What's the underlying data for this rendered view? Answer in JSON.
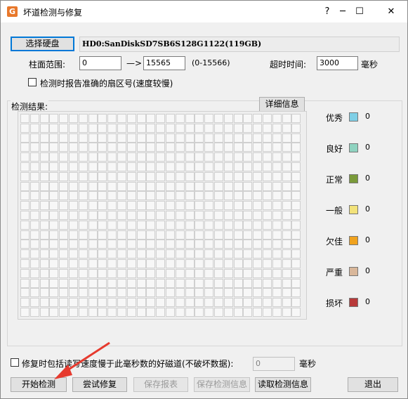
{
  "window": {
    "title": "坏道检测与修复",
    "app_icon_glyph": "G",
    "controls": {
      "help": "?",
      "minimize": "─",
      "maximize": "☐",
      "close": "✕"
    }
  },
  "disk": {
    "select_label": "选择硬盘",
    "selected": "HD0:SanDiskSD7SB6S128G1122(119GB)"
  },
  "range": {
    "label": "柱面范围:",
    "start": "0",
    "arrow": "—>",
    "end": "15565",
    "hint": "(0-15566)"
  },
  "timeout": {
    "label": "超时时间:",
    "value": "3000",
    "unit": "毫秒"
  },
  "options": {
    "report_sector_label": "检测时报告准确的扇区号(速度较慢)",
    "report_sector_checked": false,
    "repair_slow_label": "修复时包括读写速度慢于此毫秒数的好磁道(不破坏数据):",
    "repair_slow_checked": false,
    "repair_slow_value": "0",
    "repair_slow_unit": "毫秒"
  },
  "results": {
    "label": "检测结果:",
    "details_button": "详细信息"
  },
  "legend": [
    {
      "label": "优秀",
      "color": "#7fcfe6",
      "count": "0"
    },
    {
      "label": "良好",
      "color": "#8fd3c0",
      "count": "0"
    },
    {
      "label": "正常",
      "color": "#7a9a3a",
      "count": "0"
    },
    {
      "label": "一般",
      "color": "#f2e27a",
      "count": "0"
    },
    {
      "label": "欠佳",
      "color": "#f0a21e",
      "count": "0"
    },
    {
      "label": "严重",
      "color": "#d9b79a",
      "count": "0"
    },
    {
      "label": "损坏",
      "color": "#b83a3a",
      "count": "0"
    }
  ],
  "actions": {
    "start": "开始检测",
    "try_repair": "尝试修复",
    "save_report": "保存报表",
    "save_info": "保存检测信息",
    "load_info": "读取检测信息",
    "exit": "退出"
  },
  "colors": {
    "annotation_arrow": "#e63a2e",
    "focus_border": "#0078d7"
  }
}
